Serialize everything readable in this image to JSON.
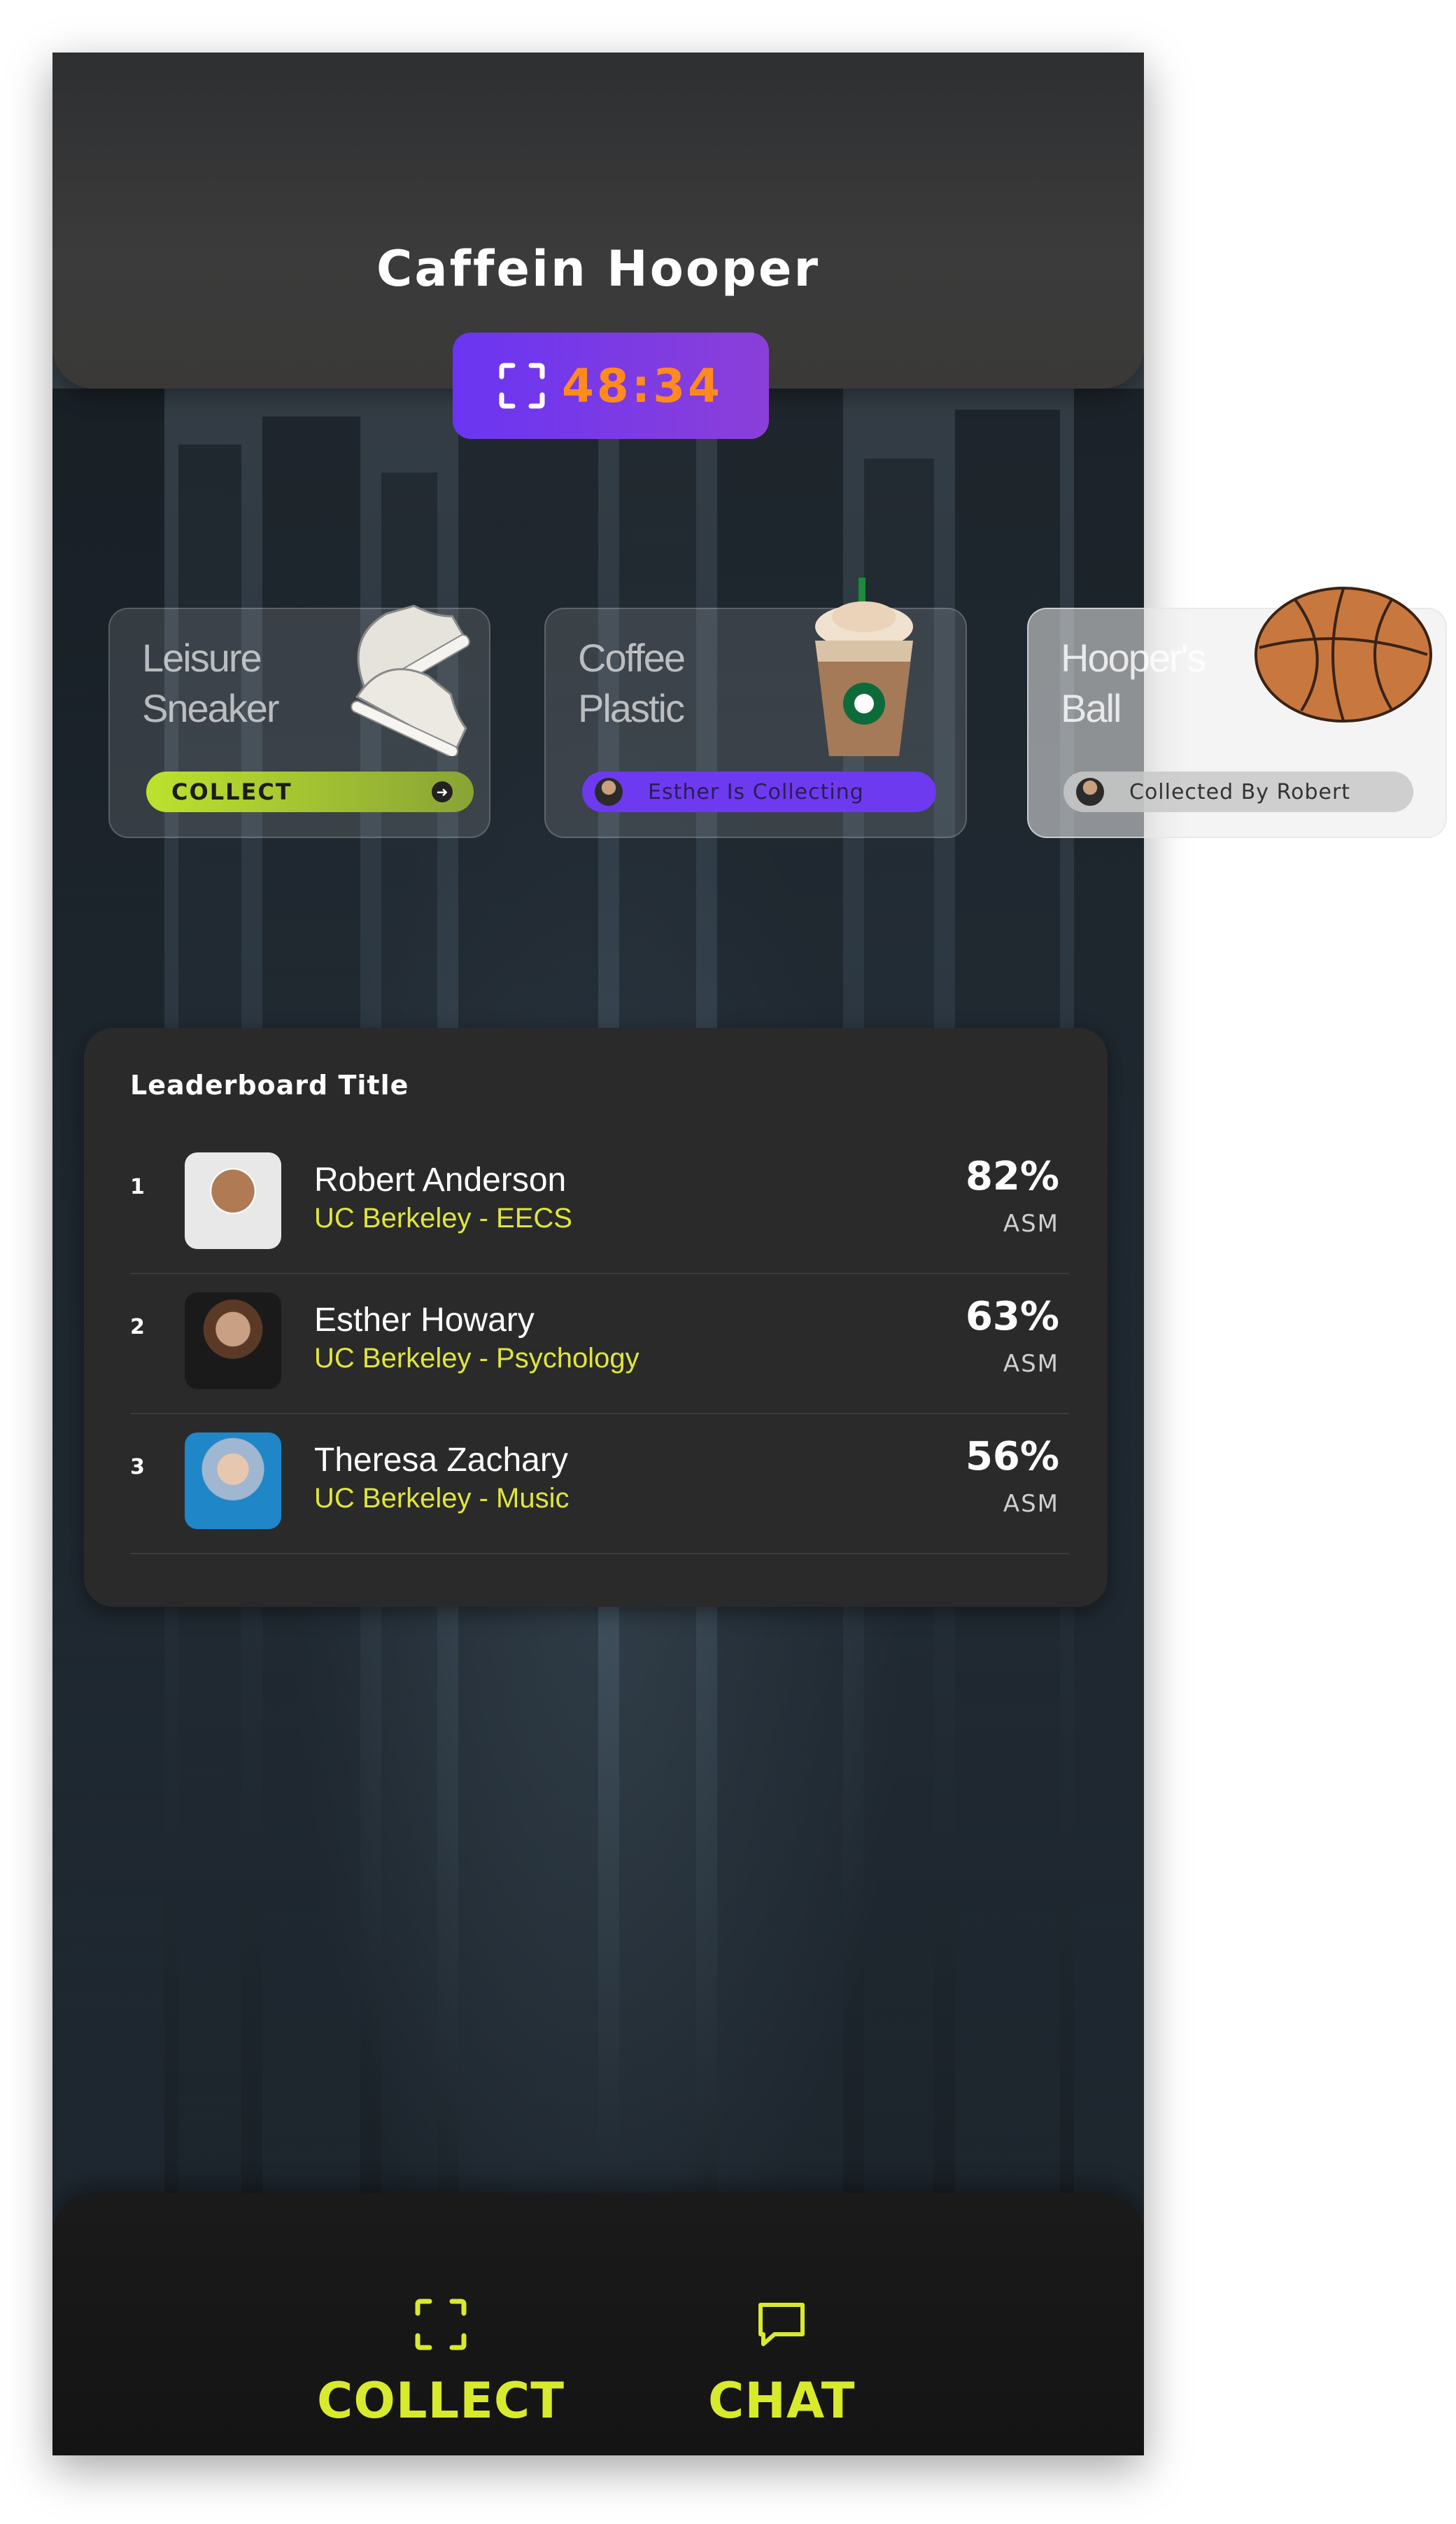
{
  "header": {
    "title": "Caffein Hooper"
  },
  "timer": {
    "value": "48:34",
    "icon": "scan-icon"
  },
  "items": [
    {
      "name_line1": "Leisure",
      "name_line2": "Sneaker",
      "action": "COLLECT",
      "image": "sneaker-image"
    },
    {
      "name_line1": "Coffee",
      "name_line2": "Plastic",
      "status": "Esther Is Collecting",
      "image": "frappuccino-cup-image"
    },
    {
      "name_line1": "Hooper's",
      "name_line2": "Ball",
      "status": "Collected By Robert",
      "image": "basketball-image"
    }
  ],
  "leaderboard": {
    "title": "Leaderboard Title",
    "rows": [
      {
        "rank": "1",
        "name": "Robert Anderson",
        "school": "UC Berkeley - EECS",
        "percent": "82%",
        "unit": "ASM"
      },
      {
        "rank": "2",
        "name": "Esther Howary",
        "school": "UC Berkeley - Psychology",
        "percent": "63%",
        "unit": "ASM"
      },
      {
        "rank": "3",
        "name": "Theresa Zachary",
        "school": "UC Berkeley - Music",
        "percent": "56%",
        "unit": "ASM"
      }
    ]
  },
  "bottom_nav": {
    "collect_label": "COLLECT",
    "chat_label": "CHAT"
  },
  "colors": {
    "accent_yellow": "#d8ea2c",
    "timer_orange": "#ff8a1e",
    "purple": "#6a35f2",
    "school_yellow": "#e0e63a"
  }
}
